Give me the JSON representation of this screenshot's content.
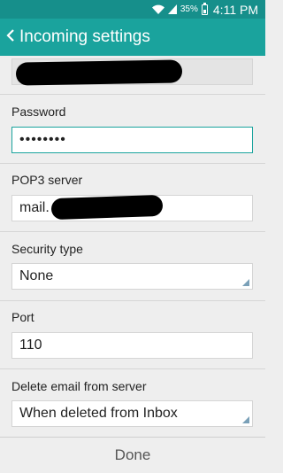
{
  "status_bar": {
    "battery_percent": "35%",
    "time": "4:11 PM",
    "icons": [
      "wifi-icon",
      "signal-icon",
      "battery-icon"
    ]
  },
  "app_bar": {
    "title": "Incoming settings",
    "back_icon": "chevron-left-icon"
  },
  "fields": {
    "username": {
      "value": ""
    },
    "password": {
      "label": "Password",
      "value": "••••••••"
    },
    "pop3_server": {
      "label": "POP3 server",
      "value": "mail."
    },
    "security_type": {
      "label": "Security type",
      "value": "None"
    },
    "port": {
      "label": "Port",
      "value": "110"
    },
    "delete_email": {
      "label": "Delete email from server",
      "value": "When deleted from Inbox"
    }
  },
  "footer": {
    "done_label": "Done"
  },
  "colors": {
    "statusbar": "#168f8b",
    "appbar": "#1aa39d",
    "accent": "#1aa39d"
  }
}
